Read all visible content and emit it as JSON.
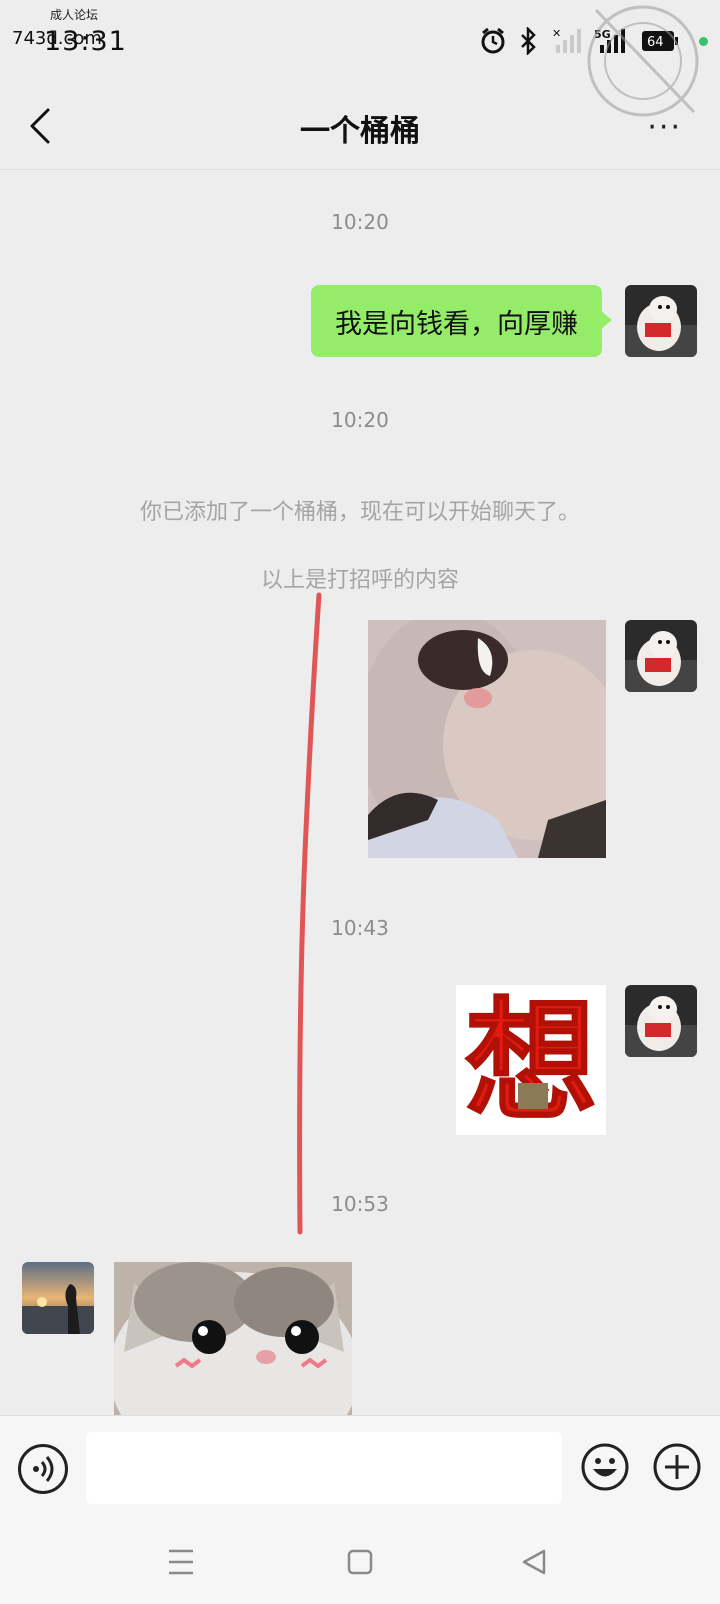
{
  "status_bar": {
    "watermark_small": "成人论坛",
    "clock": "13:31",
    "watermark_url": "743d.com",
    "network": "5G",
    "battery": "64"
  },
  "header": {
    "back_icon": "chevron-left-icon",
    "title": "一个桶桶",
    "more_label": "···"
  },
  "messages": [
    {
      "type": "timestamp",
      "text": "10:20"
    },
    {
      "type": "text",
      "side": "right",
      "text": "我是向钱看，向厚赚"
    },
    {
      "type": "timestamp",
      "text": "10:20"
    },
    {
      "type": "system",
      "text": "你已添加了一个桶桶，现在可以开始聊天了。"
    },
    {
      "type": "system",
      "text": "以上是打招呼的内容"
    },
    {
      "type": "image",
      "side": "right",
      "content": "photo-sticker"
    },
    {
      "type": "timestamp",
      "text": "10:43"
    },
    {
      "type": "image",
      "side": "right",
      "content": "sticker-xiang",
      "text": "想"
    },
    {
      "type": "timestamp",
      "text": "10:53"
    },
    {
      "type": "image",
      "side": "left",
      "content": "cat-sticker"
    }
  ],
  "input_bar": {
    "voice_icon": "voice-icon",
    "input_value": "",
    "emoji_icon": "emoji-icon",
    "plus_icon": "plus-icon"
  },
  "nav_bar": {
    "menu_icon": "menu-icon",
    "home_icon": "home-square-icon",
    "back_icon": "back-triangle-icon"
  },
  "colors": {
    "background": "#ededed",
    "sent_bubble": "#95ec69",
    "annotation_line": "#e05555"
  }
}
